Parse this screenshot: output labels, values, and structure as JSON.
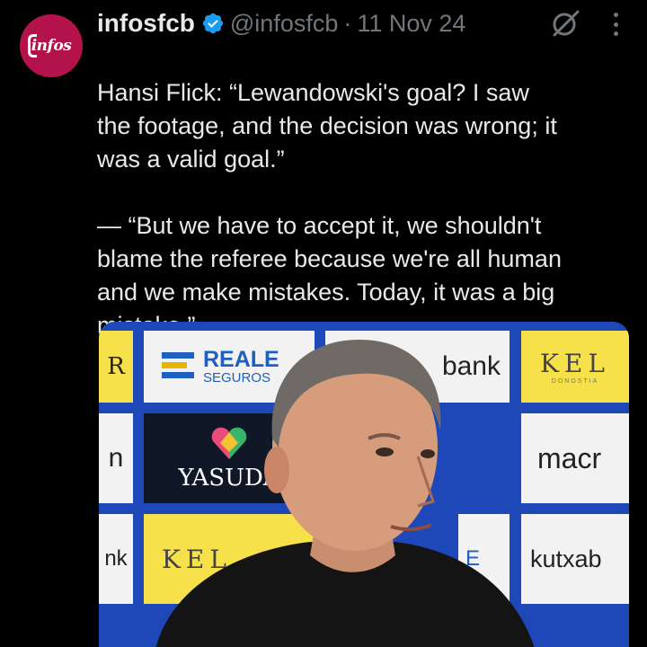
{
  "avatar": {
    "text": "infos",
    "color": "#b3134a"
  },
  "author": {
    "name": "infosfcb",
    "verified_icon": "verified-badge-icon",
    "handle": "@infosfcb",
    "separator": "·",
    "date": "11 Nov 24"
  },
  "actions": {
    "grok_icon": "grok-icon",
    "more_icon": "more-dots-icon"
  },
  "tweet": {
    "flag_icon": "germany-flag-icon",
    "lines_p1": [
      "Hansi Flick: “Lewandowski's goal? I saw",
      "the footage, and the decision was wrong; it",
      "was a valid goal.”"
    ],
    "lines_p2": [
      "— “But we have to accept it, we shouldn't",
      "blame the referee because we're all human",
      "and we make mistakes. Today, it was a big",
      "mistake.”"
    ]
  },
  "media": {
    "sponsors": {
      "reale_line1": "REALE",
      "reale_line2": "SEGUROS",
      "bank": "bank",
      "kel": "KEL",
      "yasuda": "YASUDA",
      "macr": "macr",
      "kutxab": "kutxab",
      "r": "R",
      "n": "n",
      "nk": "nk",
      "e": "E"
    },
    "colors": {
      "board_blue": "#1e47b8",
      "yellow": "#f6e14a",
      "white": "#f2f2f2"
    }
  }
}
